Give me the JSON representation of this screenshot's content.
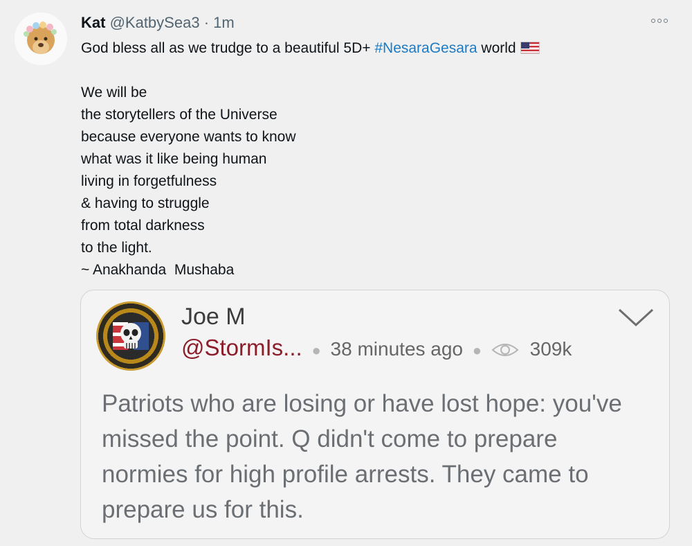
{
  "tweet": {
    "avatar_icon": "lion-cub-avatar-icon",
    "name": "Kat",
    "handle": "@KatbySea3",
    "separator": "·",
    "time": "1m",
    "more_icon": "more-options-icon",
    "text_line1_pre": "God bless all as we trudge to a beautiful 5D+ ",
    "hashtag": "#NesaraGesara",
    "text_line1_post": " world",
    "flag_icon": "us-flag-icon",
    "lines": [
      "We will be",
      "the storytellers of the Universe",
      "because everyone wants to know",
      "what was it like being human",
      "living in forgetfulness",
      "& having to struggle",
      "from total darkness",
      "to the light.",
      "~ Anakhanda  Mushaba"
    ]
  },
  "quoted": {
    "avatar_icon": "punisher-skull-emblem-icon",
    "name": "Joe M",
    "handle": "@StormIs...",
    "time": "38 minutes ago",
    "views_icon": "eye-icon",
    "views": "309k",
    "chevron_icon": "chevron-down-icon",
    "body_lines": [
      "Patriots who are losing or have lost hope: you've",
      "missed the point. Q didn't come to prepare",
      "normies for high profile arrests. They came to",
      "prepare us for this."
    ]
  },
  "colors": {
    "hashtag": "#1d7bc4",
    "quoted_handle": "#8b1e2a",
    "background": "#f0f0f0"
  }
}
